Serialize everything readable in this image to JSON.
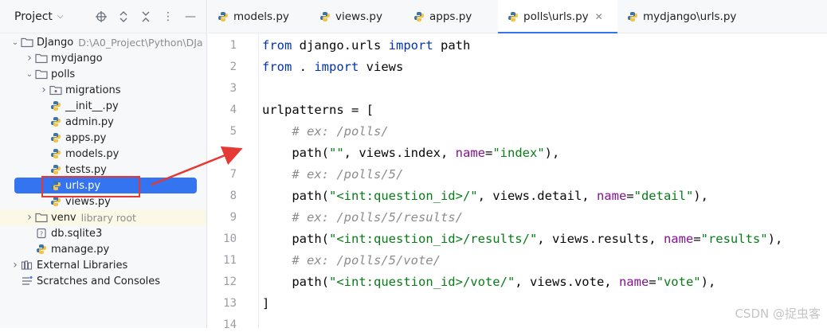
{
  "project_panel": {
    "title": "Project",
    "tree": [
      {
        "label": "DJango",
        "hint": "D:\\A0_Project\\Python\\DJa",
        "type": "folder",
        "expanded": true,
        "depth": 0
      },
      {
        "label": "mydjango",
        "type": "folder",
        "expanded": false,
        "depth": 1
      },
      {
        "label": "polls",
        "type": "folder",
        "expanded": true,
        "depth": 1
      },
      {
        "label": "migrations",
        "type": "package",
        "expanded": false,
        "depth": 2
      },
      {
        "label": "__init__.py",
        "type": "python",
        "depth": 2
      },
      {
        "label": "admin.py",
        "type": "python",
        "depth": 2
      },
      {
        "label": "apps.py",
        "type": "python",
        "depth": 2
      },
      {
        "label": "models.py",
        "type": "python",
        "depth": 2
      },
      {
        "label": "tests.py",
        "type": "python",
        "depth": 2
      },
      {
        "label": "urls.py",
        "type": "python",
        "depth": 2,
        "selected": true
      },
      {
        "label": "views.py",
        "type": "python",
        "depth": 2
      },
      {
        "label": "venv",
        "hint": "library root",
        "type": "folder",
        "expanded": false,
        "depth": 1
      },
      {
        "label": "db.sqlite3",
        "type": "db",
        "depth": 1
      },
      {
        "label": "manage.py",
        "type": "python",
        "depth": 1
      },
      {
        "label": "External Libraries",
        "type": "library",
        "expanded": false,
        "depth": 0
      },
      {
        "label": "Scratches and Consoles",
        "type": "scratch",
        "depth": 0
      }
    ]
  },
  "tabs": [
    {
      "label": "models.py"
    },
    {
      "label": "views.py"
    },
    {
      "label": "apps.py"
    },
    {
      "label": "polls\\urls.py",
      "active": true
    },
    {
      "label": "mydjango\\urls.py"
    }
  ],
  "editor": {
    "line_numbers": [
      "1",
      "2",
      "3",
      "4",
      "5",
      "6",
      "7",
      "8",
      "9",
      "10",
      "11",
      "12",
      "13",
      "14"
    ],
    "lines": [
      [
        {
          "t": "from",
          "c": "kw"
        },
        {
          "t": " django.urls "
        },
        {
          "t": "import",
          "c": "kw"
        },
        {
          "t": " path"
        }
      ],
      [
        {
          "t": "from",
          "c": "kw"
        },
        {
          "t": " . "
        },
        {
          "t": "import",
          "c": "kw"
        },
        {
          "t": " views"
        }
      ],
      [],
      [
        {
          "t": "urlpatterns = ["
        }
      ],
      [
        {
          "t": "    "
        },
        {
          "t": "# ex: /polls/",
          "c": "cmt"
        }
      ],
      [
        {
          "t": "    path("
        },
        {
          "t": "\"\"",
          "c": "str"
        },
        {
          "t": ", views.index, "
        },
        {
          "t": "name",
          "c": "param"
        },
        {
          "t": "="
        },
        {
          "t": "\"index\"",
          "c": "str"
        },
        {
          "t": "),"
        }
      ],
      [
        {
          "t": "    "
        },
        {
          "t": "# ex: /polls/5/",
          "c": "cmt"
        }
      ],
      [
        {
          "t": "    path("
        },
        {
          "t": "\"<int:question_id>/\"",
          "c": "str"
        },
        {
          "t": ", views.detail, "
        },
        {
          "t": "name",
          "c": "param"
        },
        {
          "t": "="
        },
        {
          "t": "\"detail\"",
          "c": "str"
        },
        {
          "t": "),"
        }
      ],
      [
        {
          "t": "    "
        },
        {
          "t": "# ex: /polls/5/results/",
          "c": "cmt"
        }
      ],
      [
        {
          "t": "    path("
        },
        {
          "t": "\"<int:question_id>/results/\"",
          "c": "str"
        },
        {
          "t": ", views.results, "
        },
        {
          "t": "name",
          "c": "param"
        },
        {
          "t": "="
        },
        {
          "t": "\"results\"",
          "c": "str"
        },
        {
          "t": "),"
        }
      ],
      [
        {
          "t": "    "
        },
        {
          "t": "# ex: /polls/5/vote/",
          "c": "cmt"
        }
      ],
      [
        {
          "t": "    path("
        },
        {
          "t": "\"<int:question_id>/vote/\"",
          "c": "str"
        },
        {
          "t": ", views.vote, "
        },
        {
          "t": "name",
          "c": "param"
        },
        {
          "t": "="
        },
        {
          "t": "\"vote\"",
          "c": "str"
        },
        {
          "t": "),"
        }
      ],
      [
        {
          "t": "]"
        }
      ],
      []
    ]
  },
  "watermark": "CSDN @捉虫客",
  "colors": {
    "accent": "#3574f0",
    "highlight_box": "#e53935",
    "keyword": "#0033b3",
    "string": "#067d17",
    "comment": "#8c8c8c",
    "param": "#871094"
  }
}
